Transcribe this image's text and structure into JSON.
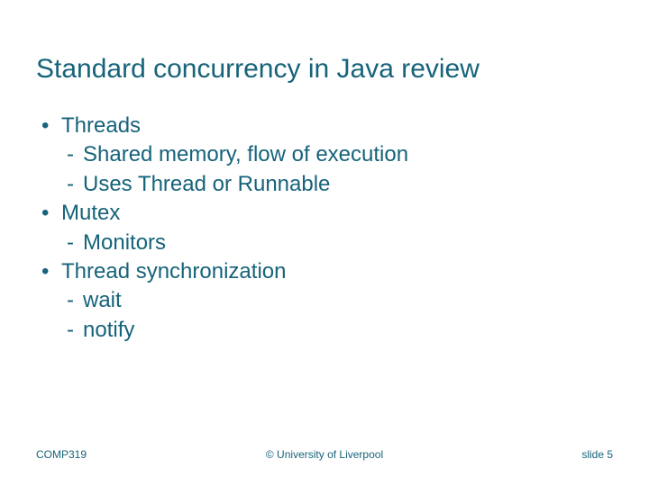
{
  "title": "Standard concurrency in Java review",
  "bullets": [
    {
      "label": "Threads",
      "subs": [
        "Shared memory, flow of execution",
        "Uses Thread or Runnable"
      ]
    },
    {
      "label": "Mutex",
      "subs": [
        "Monitors"
      ]
    },
    {
      "label": "Thread synchronization",
      "subs": [
        "wait",
        "notify"
      ]
    }
  ],
  "footer": {
    "left": "COMP319",
    "center": "© University of Liverpool",
    "right": "slide  5"
  },
  "marks": {
    "dot": "•",
    "dash": "-"
  }
}
